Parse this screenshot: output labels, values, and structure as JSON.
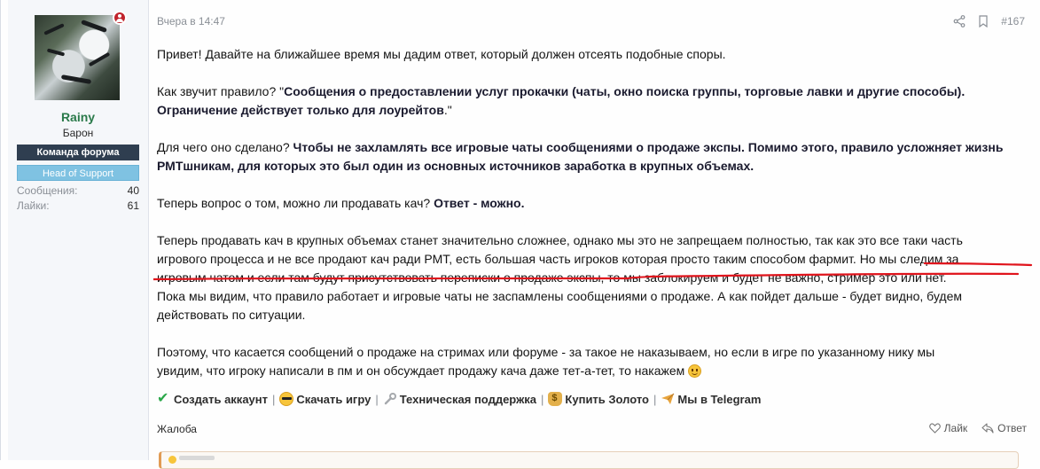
{
  "user": {
    "name": "Rainy",
    "title": "Барон",
    "banner_team": "Команда форума",
    "banner_support": "Head of Support",
    "messages_label": "Сообщения:",
    "messages_value": "40",
    "likes_label": "Лайки:",
    "likes_value": "61"
  },
  "post": {
    "date": "Вчера в 14:47",
    "number": "#167",
    "p1": "Привет! Давайте на ближайшее время мы дадим ответ, который должен отсеять подобные споры.",
    "p2_prefix": "Как звучит правило? \"",
    "p2_bold": "Сообщения о предоставлении услуг прокачки (чаты, окно поиска группы, торговые лавки и другие способы). Ограничение действует только для лоурейтов",
    "p2_suffix": ".\"",
    "p3_prefix": "Для чего оно сделано? ",
    "p3_bold": "Чтобы не захламлять все игровые чаты сообщениями о продаже экспы. Помимо этого, правило усложняет жизнь РМТшникам, для которых это был один из основных источников заработка в крупных объемах.",
    "p4_prefix": "Теперь вопрос о том, можно ли продавать кач? ",
    "p4_bold": "Ответ - можно.",
    "p5_line1": "Теперь продавать кач в крупных объемах станет значительно сложнее, однако мы это не запрещаем полностью, так как это все таки часть",
    "p5_line2": "игрового процесса и не все продают кач ради РМТ, есть большая часть игроков которая просто таким способом фармит. Но мы следим за",
    "p5_line3": "игровым чатом и если там будут присутствовать переписки о продаже экспы, то мы заблокируем и будет не важно, стример это или нет.",
    "p5_line4": "Пока мы видим, что правило работает и игровые чаты не заспамлены сообщениями о продаже. А как пойдет дальше - будет видно, будем",
    "p5_line5": "действовать по ситуации.",
    "p6_line1": "Поэтому, что касается сообщений о продаже на стримах или форуме - за такое не наказываем, но если в игре по указанному нику мы",
    "p6_line2": "увидим, что игроку написали в пм и он обсуждает продажу кача даже тет-а-тет, то накажем"
  },
  "signature": {
    "link1": "Создать аккаунт",
    "link2": "Скачать игру",
    "link3": "Техническая поддержка",
    "link4": "Купить Золото",
    "link5": "Мы в Telegram",
    "separator": "|"
  },
  "footer": {
    "complaint": "Жалоба",
    "like": "Лайк",
    "reply": "Ответ"
  },
  "colors": {
    "username": "#2a7a4a",
    "banner_team": "#2f3e50",
    "banner_support": "#7fc2e2",
    "underline": "#e0141c"
  }
}
